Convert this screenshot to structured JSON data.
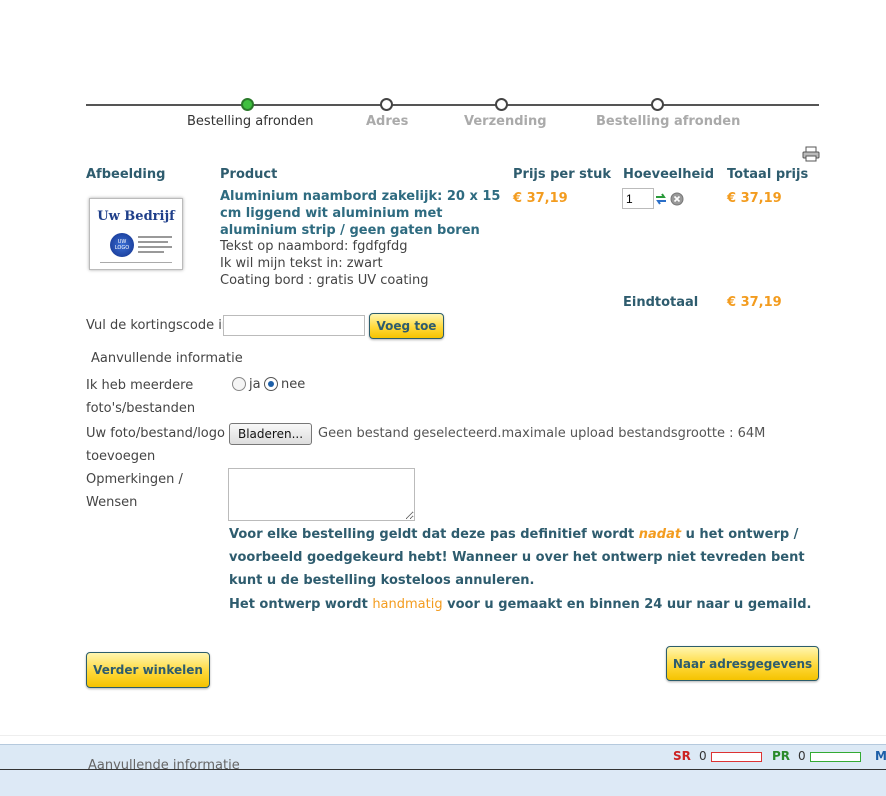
{
  "steps": [
    {
      "label": "Bestelling afronden"
    },
    {
      "label": "Adres"
    },
    {
      "label": "Verzending"
    },
    {
      "label": "Bestelling afronden"
    }
  ],
  "table": {
    "headers": {
      "image": "Afbeelding",
      "product": "Product",
      "price": "Prijs per stuk",
      "qty": "Hoeveelheid",
      "total": "Totaal prijs"
    },
    "item": {
      "thumb_title": "Uw Bedrijf",
      "thumb_logo": "UW LOGO",
      "name": "Aluminium naambord zakelijk: 20 x 15 cm liggend wit aluminium met aluminium strip / geen gaten boren",
      "opt1": "Tekst op naambord: fgdfgfdg",
      "opt2": "Ik wil mijn tekst in: zwart",
      "opt3": "Coating bord : gratis UV coating",
      "price": "€ 37,19",
      "qty": "1",
      "total": "€ 37,19"
    },
    "grand_label": "Eindtotaal",
    "grand_total": "€ 37,19"
  },
  "coupon": {
    "label": "Vul de kortingscode in",
    "button": "Voeg toe",
    "value": ""
  },
  "extra": {
    "heading": "Aanvullende informatie",
    "multi_label": "Ik heb meerdere foto's/bestanden",
    "opt_yes": "ja",
    "opt_no": "nee",
    "upload_label": "Uw foto/bestand/logo toevoegen",
    "browse": "Bladeren...",
    "upload_info": "Geen bestand geselecteerd.maximale upload bestandsgrootte : 64M",
    "remarks_label": "Opmerkingen / Wensen"
  },
  "notice": {
    "p1a": "Voor elke bestelling geldt dat deze pas definitief wordt ",
    "p1b": "nadat",
    "p1c": " u het ontwerp / voorbeeld goedgekeurd hebt! Wanneer u over het ontwerp niet tevreden bent kunt u de bestelling kosteloos annuleren.",
    "p2a": "Het ontwerp wordt ",
    "p2b": "handmatig",
    "p2c": " voor u gemaakt en binnen 24 uur naar u gemaild."
  },
  "buttons": {
    "continue": "Verder winkelen",
    "next": "Naar adresgegevens"
  },
  "statusbar": {
    "sr": "SR",
    "sr_val": "0",
    "pr": "PR",
    "pr_val": "0",
    "m": "M",
    "behind_text": "Aanvullende informatie"
  },
  "colors": {
    "accent": "#f39c1f",
    "teal": "#2e5c6e",
    "button": "#ffd93b"
  }
}
